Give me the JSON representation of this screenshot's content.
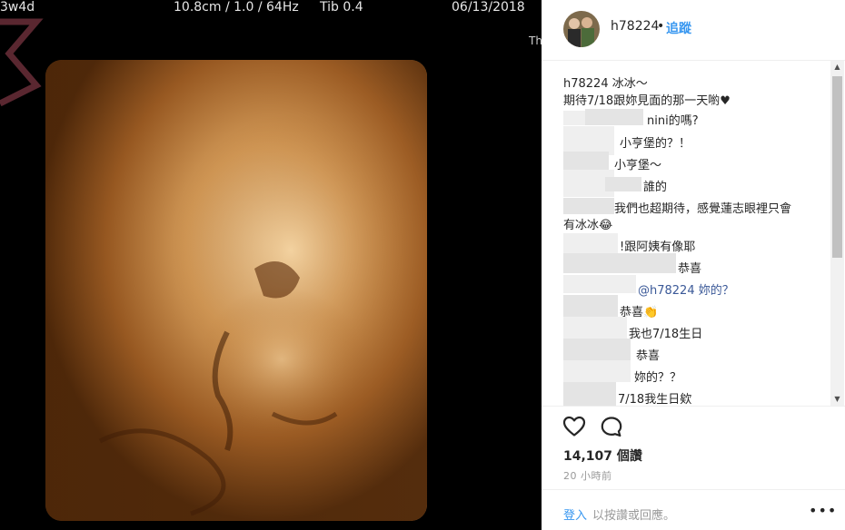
{
  "ultrasound": {
    "gestational_age": "3w4d",
    "probe_settings": "10.8cm / 1.0 / 64Hz",
    "tib": "Tib  0.4",
    "date": "06/13/2018",
    "corner_label": "Th"
  },
  "post": {
    "username": "h78224",
    "separator": "•",
    "follow_label": "追蹤",
    "caption_line1": "h78224 冰冰～",
    "caption_line2": "期待7/18跟妳見面的那一天喲♥",
    "comments": [
      "nini的嗎?",
      "小亨堡的？！",
      "小亨堡～",
      "誰的",
      "我們也超期待，感覺蓮志眼裡只會",
      "有冰冰😂",
      "!跟阿姨有像耶",
      "恭喜",
      "@h78224 妳的？",
      "恭喜👏",
      "我也7/18生日",
      "恭喜",
      "妳的？？",
      "7/18我生日欸"
    ],
    "likes": "14,107 個讚",
    "time_ago": "20 小時前",
    "login_label": "登入",
    "login_rest": "以按讚或回應。",
    "more_label": "•••"
  },
  "colors": {
    "link_blue": "#3897f0",
    "text": "#262626",
    "muted": "#999999",
    "scan_orange": "#c8833e"
  }
}
